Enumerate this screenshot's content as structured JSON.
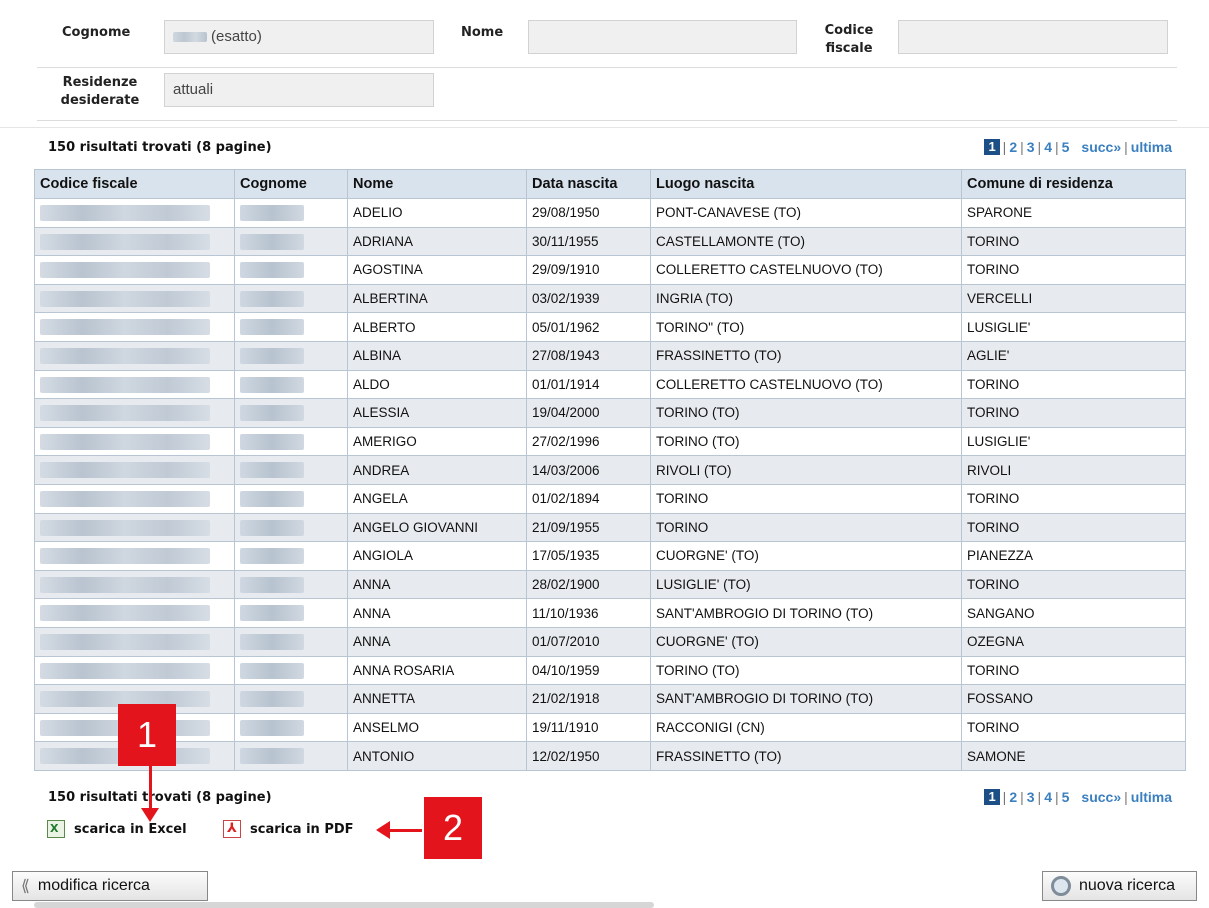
{
  "form": {
    "cognome_label": "Cognome",
    "cognome_value": "(esatto)",
    "nome_label": "Nome",
    "nome_value": "",
    "codice_label": "Codice fiscale",
    "codice_value": "",
    "residenze_label": "Residenze desiderate",
    "residenze_value": "attuali"
  },
  "results": {
    "summary": "150 risultati trovati (8 pagine)",
    "pager": {
      "current": "1",
      "pages": [
        "2",
        "3",
        "4",
        "5"
      ],
      "next": "succ»",
      "last": "ultima"
    }
  },
  "table": {
    "headers": [
      "Codice fiscale",
      "Cognome",
      "Nome",
      "Data nascita",
      "Luogo nascita",
      "Comune di residenza"
    ],
    "rows": [
      {
        "nome": "ADELIO",
        "data": "29/08/1950",
        "luogo": "PONT-CANAVESE (TO)",
        "comune": "SPARONE"
      },
      {
        "nome": "ADRIANA",
        "data": "30/11/1955",
        "luogo": "CASTELLAMONTE (TO)",
        "comune": "TORINO"
      },
      {
        "nome": "AGOSTINA",
        "data": "29/09/1910",
        "luogo": "COLLERETTO CASTELNUOVO (TO)",
        "comune": "TORINO"
      },
      {
        "nome": "ALBERTINA",
        "data": "03/02/1939",
        "luogo": "INGRIA (TO)",
        "comune": "VERCELLI"
      },
      {
        "nome": "ALBERTO",
        "data": "05/01/1962",
        "luogo": "TORINO\" (TO)",
        "comune": "LUSIGLIE'"
      },
      {
        "nome": "ALBINA",
        "data": "27/08/1943",
        "luogo": "FRASSINETTO (TO)",
        "comune": "AGLIE'"
      },
      {
        "nome": "ALDO",
        "data": "01/01/1914",
        "luogo": "COLLERETTO CASTELNUOVO (TO)",
        "comune": "TORINO"
      },
      {
        "nome": "ALESSIA",
        "data": "19/04/2000",
        "luogo": "TORINO (TO)",
        "comune": "TORINO"
      },
      {
        "nome": "AMERIGO",
        "data": "27/02/1996",
        "luogo": "TORINO (TO)",
        "comune": "LUSIGLIE'"
      },
      {
        "nome": "ANDREA",
        "data": "14/03/2006",
        "luogo": "RIVOLI (TO)",
        "comune": "RIVOLI"
      },
      {
        "nome": "ANGELA",
        "data": "01/02/1894",
        "luogo": "TORINO",
        "comune": "TORINO"
      },
      {
        "nome": "ANGELO GIOVANNI",
        "data": "21/09/1955",
        "luogo": "TORINO",
        "comune": "TORINO"
      },
      {
        "nome": "ANGIOLA",
        "data": "17/05/1935",
        "luogo": "CUORGNE' (TO)",
        "comune": "PIANEZZA"
      },
      {
        "nome": "ANNA",
        "data": "28/02/1900",
        "luogo": "LUSIGLIE' (TO)",
        "comune": "TORINO"
      },
      {
        "nome": "ANNA",
        "data": "11/10/1936",
        "luogo": "SANT'AMBROGIO DI TORINO (TO)",
        "comune": "SANGANO"
      },
      {
        "nome": "ANNA",
        "data": "01/07/2010",
        "luogo": "CUORGNE' (TO)",
        "comune": "OZEGNA"
      },
      {
        "nome": "ANNA ROSARIA",
        "data": "04/10/1959",
        "luogo": "TORINO (TO)",
        "comune": "TORINO"
      },
      {
        "nome": "ANNETTA",
        "data": "21/02/1918",
        "luogo": "SANT'AMBROGIO DI TORINO (TO)",
        "comune": "FOSSANO"
      },
      {
        "nome": "ANSELMO",
        "data": "19/11/1910",
        "luogo": "RACCONIGI (CN)",
        "comune": "TORINO"
      },
      {
        "nome": "ANTONIO",
        "data": "12/02/1950",
        "luogo": "FRASSINETTO (TO)",
        "comune": "SAMONE"
      }
    ]
  },
  "downloads": {
    "excel": "scarica in Excel",
    "pdf": "scarica in PDF"
  },
  "annotations": {
    "one": "1",
    "two": "2",
    "color": "#e3141b"
  },
  "buttons": {
    "modifica": "modifica ricerca",
    "nuova": "nuova ricerca"
  },
  "icons": [
    "rewind-icon",
    "excel-icon",
    "pdf-icon",
    "magnifier-icon"
  ]
}
